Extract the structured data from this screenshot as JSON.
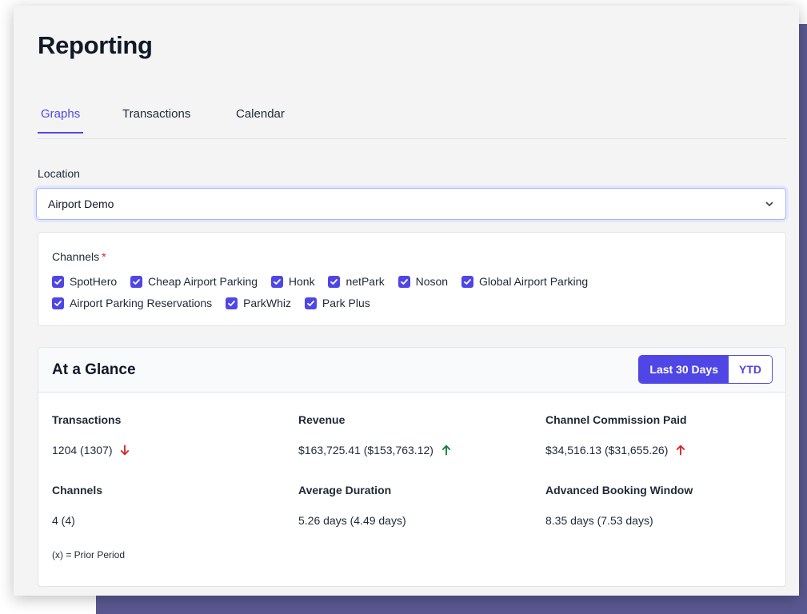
{
  "page": {
    "title": "Reporting"
  },
  "tabs": [
    {
      "label": "Graphs",
      "active": true
    },
    {
      "label": "Transactions",
      "active": false
    },
    {
      "label": "Calendar",
      "active": false
    }
  ],
  "location": {
    "label": "Location",
    "selected": "Airport Demo",
    "icon": "chevron-down-icon"
  },
  "channels": {
    "title": "Channels",
    "required_mark": "*",
    "items": [
      {
        "label": "SpotHero",
        "checked": true
      },
      {
        "label": "Cheap Airport Parking",
        "checked": true
      },
      {
        "label": "Honk",
        "checked": true
      },
      {
        "label": "netPark",
        "checked": true
      },
      {
        "label": "Noson",
        "checked": true
      },
      {
        "label": "Global Airport Parking",
        "checked": true
      },
      {
        "label": "Airport Parking Reservations",
        "checked": true
      },
      {
        "label": "ParkWhiz",
        "checked": true
      },
      {
        "label": "Park Plus",
        "checked": true
      }
    ]
  },
  "glance": {
    "title": "At a Glance",
    "range_buttons": [
      {
        "label": "Last 30 Days",
        "active": true
      },
      {
        "label": "YTD",
        "active": false
      }
    ],
    "stats": [
      {
        "label": "Transactions",
        "value": "1204 (1307)",
        "trend": "down",
        "trend_color": "#dc2626"
      },
      {
        "label": "Revenue",
        "value": "$163,725.41 ($153,763.12)",
        "trend": "up",
        "trend_color": "#15803d"
      },
      {
        "label": "Channel Commission Paid",
        "value": "$34,516.13 ($31,655.26)",
        "trend": "up",
        "trend_color": "#dc2626"
      },
      {
        "label": "Channels",
        "value": "4 (4)",
        "trend": "none"
      },
      {
        "label": "Average Duration",
        "value": "5.26 days (4.49 days)",
        "trend": "none"
      },
      {
        "label": "Advanced Booking Window",
        "value": "8.35 days (7.53 days)",
        "trend": "none"
      }
    ],
    "footnote": "(x) = Prior Period"
  },
  "colors": {
    "accent": "#4f46e5",
    "backdrop": "#5a5890",
    "panel": "#f4f4f5",
    "trend_down": "#dc2626",
    "trend_up": "#15803d"
  }
}
